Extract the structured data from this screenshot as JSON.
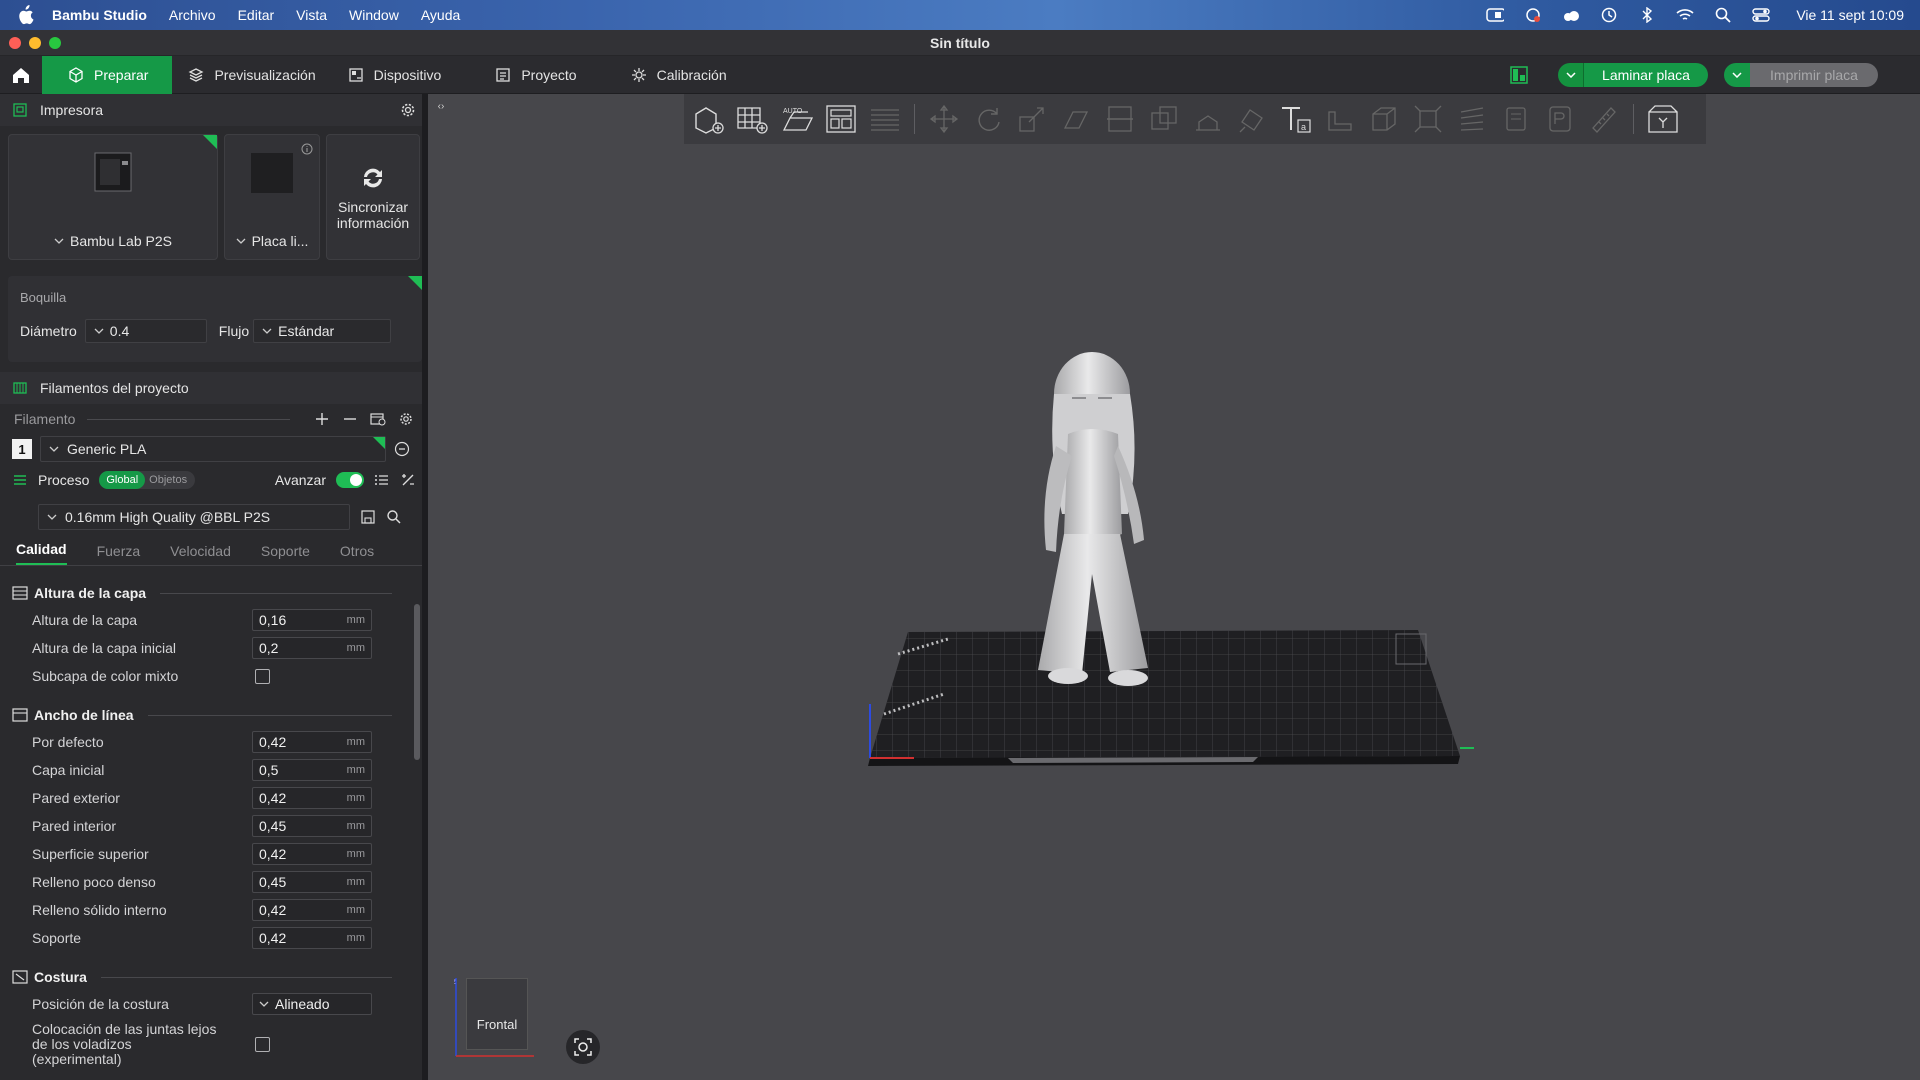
{
  "menubar": {
    "app": "Bambu Studio",
    "items": [
      "Archivo",
      "Editar",
      "Vista",
      "Window",
      "Ayuda"
    ],
    "clock": "Vie 11 sept 10:09"
  },
  "window": {
    "title": "Sin título"
  },
  "tabs": [
    {
      "label": "Preparar",
      "icon": "cube-icon"
    },
    {
      "label": "Previsualización",
      "icon": "layers-icon"
    },
    {
      "label": "Dispositivo",
      "icon": "device-icon"
    },
    {
      "label": "Proyecto",
      "icon": "project-icon"
    },
    {
      "label": "Calibración",
      "icon": "calibration-icon"
    }
  ],
  "actions": {
    "slice": "Laminar placa",
    "print": "Imprimir placa"
  },
  "printer": {
    "header": "Impresora",
    "model": "Bambu Lab P2S",
    "plate": "Placa li...",
    "sync_line1": "Sincronizar",
    "sync_line2": "información"
  },
  "nozzle": {
    "caption": "Boquilla",
    "diameter_label": "Diámetro",
    "diameter_value": "0.4",
    "flow_label": "Flujo",
    "flow_value": "Estándar"
  },
  "filaments": {
    "header": "Filamentos del proyecto",
    "label": "Filamento",
    "items": [
      {
        "slot": "1",
        "name": "Generic PLA",
        "color": "#f2f2f2"
      }
    ]
  },
  "process": {
    "label": "Proceso",
    "global": "Global",
    "objects": "Objetos",
    "advanced": "Avanzar",
    "preset": "0.16mm High Quality @BBL P2S"
  },
  "subtabs": [
    "Calidad",
    "Fuerza",
    "Velocidad",
    "Soporte",
    "Otros"
  ],
  "groups": {
    "layer": {
      "title": "Altura de la capa",
      "rows": [
        {
          "name": "Altura de la capa",
          "value": "0,16",
          "unit": "mm"
        },
        {
          "name": "Altura de la capa inicial",
          "value": "0,2",
          "unit": "mm"
        }
      ],
      "mixed": "Subcapa de color mixto"
    },
    "width": {
      "title": "Ancho de línea",
      "rows": [
        {
          "name": "Por defecto",
          "value": "0,42",
          "unit": "mm"
        },
        {
          "name": "Capa inicial",
          "value": "0,5",
          "unit": "mm"
        },
        {
          "name": "Pared exterior",
          "value": "0,42",
          "unit": "mm"
        },
        {
          "name": "Pared interior",
          "value": "0,45",
          "unit": "mm"
        },
        {
          "name": "Superficie superior",
          "value": "0,42",
          "unit": "mm"
        },
        {
          "name": "Relleno poco denso",
          "value": "0,45",
          "unit": "mm"
        },
        {
          "name": "Relleno sólido interno",
          "value": "0,42",
          "unit": "mm"
        },
        {
          "name": "Soporte",
          "value": "0,42",
          "unit": "mm"
        }
      ]
    },
    "seam": {
      "title": "Costura",
      "position_label": "Posición de la costura",
      "position_value": "Alineado",
      "overhang_line1": "Colocación de las juntas lejos",
      "overhang_line2": "de los voladizos",
      "overhang_line3": "(experimental)"
    }
  },
  "viewport": {
    "view_label": "Frontal",
    "axis_x": "x",
    "axis_z": "z"
  },
  "colors": {
    "accent": "#159947",
    "panel": "#2a2a2d",
    "viewport": "#47474b"
  }
}
